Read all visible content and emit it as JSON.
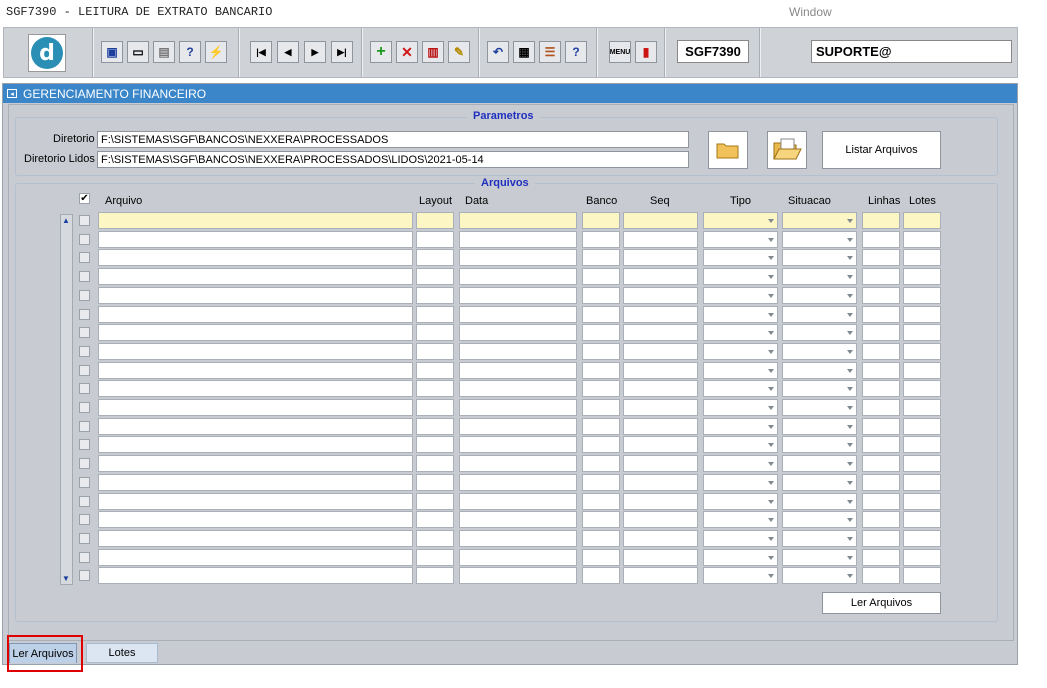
{
  "window": {
    "title": "SGF7390 - LEITURA DE EXTRATO BANCARIO",
    "menu_window": "Window"
  },
  "toolbar": {
    "form_name": "SGF7390",
    "user": "SUPORTE@"
  },
  "form": {
    "title": "GERENCIAMENTO FINANCEIRO",
    "parametros": {
      "frame_title": "Parametros",
      "diretorio_label": "Diretorio",
      "diretorio_value": "F:\\SISTEMAS\\SGF\\BANCOS\\NEXXERA\\PROCESSADOS",
      "diretorio_lidos_label": "Diretorio Lidos",
      "diretorio_lidos_value": "F:\\SISTEMAS\\SGF\\BANCOS\\NEXXERA\\PROCESSADOS\\LIDOS\\2021-05-14",
      "listar_button": "Listar Arquivos"
    },
    "arquivos": {
      "frame_title": "Arquivos",
      "columns": {
        "arquivo": "Arquivo",
        "layout": "Layout",
        "data": "Data",
        "banco": "Banco",
        "seq": "Seq",
        "tipo": "Tipo",
        "situacao": "Situacao",
        "linhas": "Linhas",
        "lotes": "Lotes"
      },
      "ler_button": "Ler Arquivos"
    }
  },
  "tabs": {
    "ler_arquivos": "Ler Arquivos",
    "lotes": "Lotes"
  },
  "colors": {
    "title_bar": "#3a86c8",
    "frame_title": "#1f2fbf",
    "active_row": "#fcf6c4",
    "highlight_box": "#e00000"
  }
}
